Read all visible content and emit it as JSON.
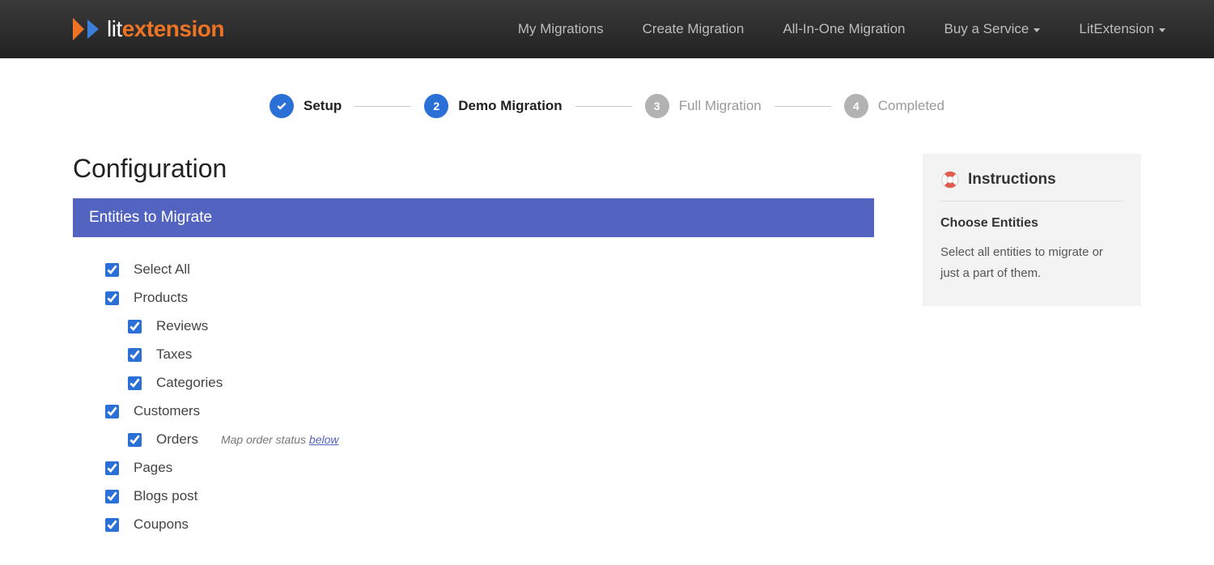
{
  "brand": {
    "lit": "lit",
    "extension": "extension"
  },
  "nav": {
    "my_migrations": "My Migrations",
    "create_migration": "Create Migration",
    "all_in_one": "All-In-One Migration",
    "buy_service": "Buy a Service",
    "litextension": "LitExtension"
  },
  "steps": {
    "setup": "Setup",
    "demo": "Demo Migration",
    "full": "Full Migration",
    "completed": "Completed",
    "n2": "2",
    "n3": "3",
    "n4": "4"
  },
  "page_title": "Configuration",
  "section_title": "Entities to Migrate",
  "entities": {
    "select_all": "Select All",
    "products": "Products",
    "reviews": "Reviews",
    "taxes": "Taxes",
    "categories": "Categories",
    "customers": "Customers",
    "orders": "Orders",
    "orders_hint_prefix": "Map order status ",
    "orders_hint_link": "below",
    "pages": "Pages",
    "blogs_post": "Blogs post",
    "coupons": "Coupons"
  },
  "sidebar": {
    "instructions": "Instructions",
    "choose_entities": "Choose Entities",
    "desc": "Select all entities to migrate or just a part of them."
  }
}
